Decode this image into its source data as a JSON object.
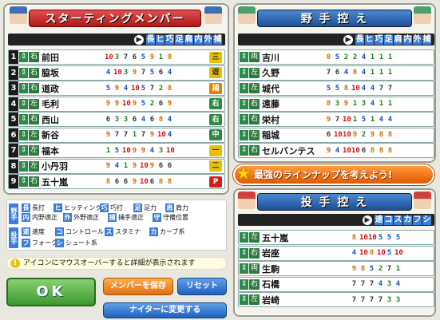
{
  "starting": {
    "title": "スターティングメンバー",
    "stat_headers": [
      "長",
      "ヒ",
      "巧",
      "足",
      "肩",
      "内",
      "外",
      "捕"
    ],
    "rows": [
      {
        "num": "1",
        "hand": "右",
        "name": "前田",
        "vals": [
          "10",
          "3",
          "7",
          "6",
          "5",
          "9",
          "1",
          "8"
        ],
        "badge": "三",
        "badge_color": "#e8c000"
      },
      {
        "num": "2",
        "hand": "右",
        "name": "脇坂",
        "vals": [
          "4",
          "10",
          "3",
          "9",
          "7",
          "5",
          "6",
          "4"
        ],
        "badge": "遊",
        "badge_color": "#e8c000"
      },
      {
        "num": "3",
        "hand": "右",
        "name": "道政",
        "vals": [
          "5",
          "9",
          "4",
          "10",
          "5",
          "7",
          "2",
          "8"
        ],
        "badge": "捕",
        "badge_color": "#e08000"
      },
      {
        "num": "4",
        "hand": "左",
        "name": "毛利",
        "vals": [
          "9",
          "9",
          "10",
          "9",
          "5",
          "2",
          "6",
          "9"
        ],
        "badge": "右",
        "badge_color": "#2f8a3a"
      },
      {
        "num": "5",
        "hand": "右",
        "name": "西山",
        "vals": [
          "6",
          "3",
          "3",
          "6",
          "4",
          "6",
          "8",
          "4"
        ],
        "badge": "右",
        "badge_color": "#2f8a3a"
      },
      {
        "num": "6",
        "hand": "左",
        "name": "新谷",
        "vals": [
          "9",
          "7",
          "7",
          "1",
          "7",
          "9",
          "10",
          "4"
        ],
        "badge": "中",
        "badge_color": "#2f8a3a"
      },
      {
        "num": "7",
        "hand": "左",
        "name": "福本",
        "vals": [
          "1",
          "5",
          "10",
          "9",
          "9",
          "4",
          "3",
          "10"
        ],
        "badge": "一",
        "badge_color": "#e8c000"
      },
      {
        "num": "8",
        "hand": "左",
        "name": "小丹羽",
        "vals": [
          "9",
          "4",
          "1",
          "9",
          "10",
          "9",
          "6",
          "6"
        ],
        "badge": "二",
        "badge_color": "#e8c000"
      },
      {
        "num": "9",
        "hand": "右",
        "name": "五十嵐",
        "vals": [
          "8",
          "6",
          "6",
          "9",
          "10",
          "6",
          "8",
          "8"
        ],
        "badge": "P",
        "badge_color": "#d02020"
      }
    ]
  },
  "bench": {
    "title": "野 手 控 え",
    "stat_headers": [
      "長",
      "ヒ",
      "巧",
      "足",
      "肩",
      "内",
      "外",
      "捕"
    ],
    "rows": [
      {
        "hand": "両",
        "name": "吉川",
        "vals": [
          "8",
          "5",
          "2",
          "2",
          "4",
          "1",
          "1",
          "1"
        ]
      },
      {
        "hand": "左",
        "name": "久野",
        "vals": [
          "7",
          "6",
          "4",
          "8",
          "4",
          "1",
          "1",
          "1"
        ]
      },
      {
        "hand": "左",
        "name": "城代",
        "vals": [
          "5",
          "5",
          "8",
          "10",
          "4",
          "4",
          "7",
          "7"
        ]
      },
      {
        "hand": "右",
        "name": "遠藤",
        "vals": [
          "8",
          "3",
          "9",
          "1",
          "3",
          "4",
          "1",
          "1"
        ]
      },
      {
        "hand": "右",
        "name": "栄村",
        "vals": [
          "9",
          "7",
          "10",
          "1",
          "5",
          "1",
          "4",
          "4"
        ]
      },
      {
        "hand": "左",
        "name": "稲城",
        "vals": [
          "6",
          "10",
          "10",
          "9",
          "2",
          "9",
          "8",
          "8"
        ]
      },
      {
        "hand": "右",
        "name": "セルバンテス",
        "vals": [
          "9",
          "4",
          "10",
          "10",
          "6",
          "8",
          "8",
          "8"
        ]
      }
    ]
  },
  "banner": "最強のラインナップを考えよう!",
  "pitchers": {
    "title": "投 手 控 え",
    "stat_headers": [
      "速",
      "コ",
      "ス",
      "カ",
      "フ",
      "シ"
    ],
    "rows": [
      {
        "hand": "左",
        "name": "五十嵐",
        "vals": [
          "8",
          "10",
          "10",
          "5",
          "5",
          "5"
        ]
      },
      {
        "hand": "右",
        "name": "岩座",
        "vals": [
          "4",
          "10",
          "8",
          "10",
          "5",
          "10"
        ]
      },
      {
        "hand": "両",
        "name": "生駒",
        "vals": [
          "9",
          "8",
          "5",
          "2",
          "7",
          "1"
        ]
      },
      {
        "hand": "右",
        "name": "石橋",
        "vals": [
          "7",
          "7",
          "7",
          "4",
          "3",
          "4"
        ]
      },
      {
        "hand": "左",
        "name": "岩崎",
        "vals": [
          "7",
          "7",
          "7",
          "7",
          "3",
          "3"
        ]
      }
    ]
  },
  "legend": {
    "fielder_cat": "野手",
    "pitcher_cat": "投手",
    "items": [
      {
        "ic": "長",
        "label": "長打"
      },
      {
        "ic": "ヒ",
        "label": "ヒッティング"
      },
      {
        "ic": "巧",
        "label": "巧打"
      },
      {
        "ic": "足",
        "label": "足力"
      },
      {
        "ic": "肩",
        "label": "肩力"
      },
      {
        "ic": "内",
        "label": "内野適正"
      },
      {
        "ic": "外",
        "label": "外野適正"
      },
      {
        "ic": "捕",
        "label": "捕手適正"
      },
      {
        "ic": "守",
        "label": "守備位置"
      },
      {
        "ic": "速",
        "label": "速度"
      },
      {
        "ic": "コ",
        "label": "コントロール"
      },
      {
        "ic": "ス",
        "label": "スタミナ"
      },
      {
        "ic": "カ",
        "label": "カーブ系"
      },
      {
        "ic": "フ",
        "label": "フォーク系"
      },
      {
        "ic": "シ",
        "label": "シュート系"
      }
    ]
  },
  "tip": "アイコンにマウスオーバーすると詳細が表示されます",
  "buttons": {
    "ok": "OK",
    "save": "メンバーを保存",
    "reset": "リセット",
    "night": "ナイターに変更する"
  }
}
